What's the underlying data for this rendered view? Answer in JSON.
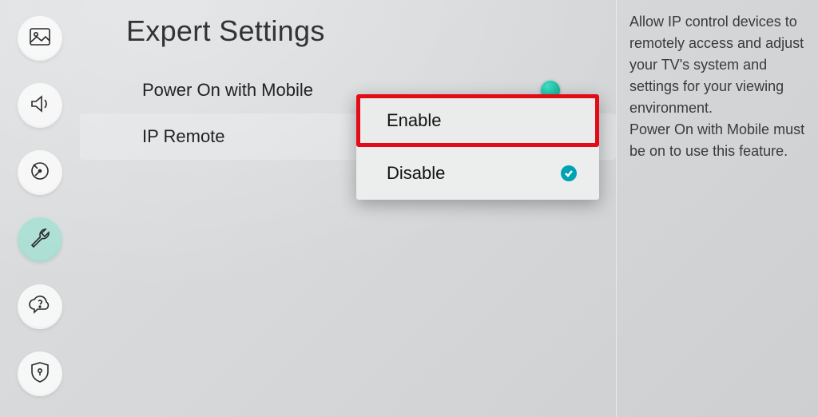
{
  "page": {
    "title": "Expert Settings"
  },
  "sidebar": {
    "items": [
      {
        "name": "picture"
      },
      {
        "name": "sound"
      },
      {
        "name": "broadcast"
      },
      {
        "name": "general",
        "active": true
      },
      {
        "name": "support"
      },
      {
        "name": "privacy"
      }
    ]
  },
  "settings": {
    "power_on_mobile": {
      "label": "Power On with Mobile",
      "enabled": true
    },
    "ip_remote": {
      "label": "IP Remote",
      "options": [
        "Enable",
        "Disable"
      ],
      "selected": "Disable",
      "highlighted": "Enable"
    }
  },
  "info": {
    "text": "Allow IP control devices to remotely access and adjust your TV's system and settings for your viewing environment.\nPower On with Mobile must be on to use this feature."
  }
}
